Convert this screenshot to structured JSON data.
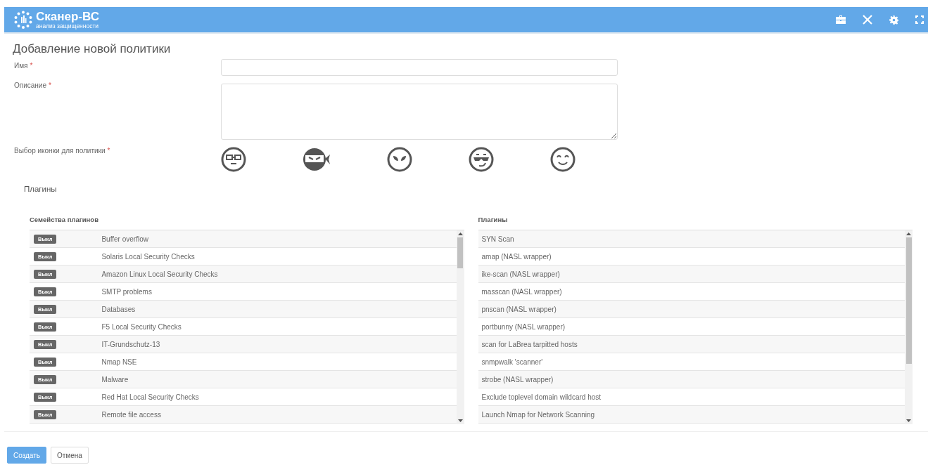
{
  "header": {
    "logo_title": "Сканер-ВС",
    "logo_subtitle": "анализ защищенности"
  },
  "page_title": "Добавление новой политики",
  "fields": [
    {
      "label": "Имя",
      "required_mark": "*",
      "kind": "input"
    },
    {
      "label": "Описание",
      "required_mark": "*",
      "kind": "textarea"
    }
  ],
  "icon_choice": {
    "label": "Выбор иконки для политики",
    "required_mark": "*"
  },
  "plugins_section": {
    "title": "Плагины",
    "families": {
      "heading": "Семейства плагинов",
      "rows": [
        {
          "badge": "Выкл",
          "on": false,
          "name": "Buffer overflow"
        },
        {
          "badge": "Выкл",
          "on": false,
          "name": "Solaris Local Security Checks"
        },
        {
          "badge": "Выкл",
          "on": false,
          "name": "Amazon Linux Local Security Checks"
        },
        {
          "badge": "Выкл",
          "on": false,
          "name": "SMTP problems"
        },
        {
          "badge": "Выкл",
          "on": false,
          "name": "Databases"
        },
        {
          "badge": "Выкл",
          "on": false,
          "name": "F5 Local Security Checks"
        },
        {
          "badge": "Выкл",
          "on": false,
          "name": "IT-Grundschutz-13"
        },
        {
          "badge": "Выкл",
          "on": false,
          "name": "Nmap NSE"
        },
        {
          "badge": "Выкл",
          "on": false,
          "name": "Malware"
        },
        {
          "badge": "Выкл",
          "on": false,
          "name": "Red Hat Local Security Checks"
        },
        {
          "badge": "Выкл",
          "on": false,
          "name": "Remote file access"
        }
      ]
    },
    "plugins": {
      "heading": "Плагины",
      "rows": [
        "SYN Scan",
        "amap (NASL wrapper)",
        "ike-scan (NASL wrapper)",
        "masscan (NASL wrapper)",
        "pnscan (NASL wrapper)",
        "portbunny (NASL wrapper)",
        "scan for LaBrea tarpitted hosts",
        "snmpwalk 'scanner'",
        "strobe (NASL wrapper)",
        "Exclude toplevel domain wildcard host",
        "Launch Nmap for Network Scanning"
      ]
    }
  },
  "buttons": [
    {
      "label": "Создать",
      "kind": "primary"
    },
    {
      "label": "Отмена",
      "kind": "default"
    }
  ]
}
